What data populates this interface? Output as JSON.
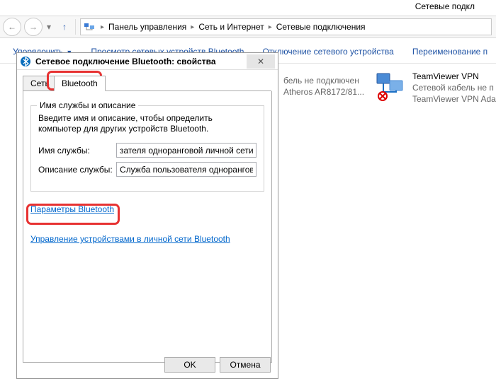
{
  "window": {
    "title": "Сетевые подкл"
  },
  "breadcrumb": {
    "seg1": "Панель управления",
    "seg2": "Сеть и Интернет",
    "seg3": "Сетевые подключения"
  },
  "cmdbar": {
    "organize": "Упорядочить",
    "view_bt": "Просмотр сетевых устройств Bluetooth",
    "disable": "Отключение сетевого устройства",
    "rename": "Переименование п"
  },
  "connections": {
    "item1": {
      "title": "TeamViewer VPN",
      "line1": "Сетевой кабель не п",
      "line2": "TeamViewer VPN Ada"
    },
    "item2_line1": "бель не подключен",
    "item2_line2": "Atheros AR8172/81..."
  },
  "dialog": {
    "title": "Сетевое подключение Bluetooth: свойства",
    "tabs": {
      "net": "Сеть",
      "bt": "Bluetooth"
    },
    "group": {
      "title": "Имя службы и описание",
      "desc": "Введите имя и описание, чтобы определить компьютер для других устройств Bluetooth.",
      "name_label": "Имя службы:",
      "name_value": "зателя одноранговой личной сети",
      "desc_label": "Описание службы:",
      "desc_value": "Служба пользователя однорангов"
    },
    "link_params": "Параметры Bluetooth",
    "link_manage": "Управление устройствами в личной сети Bluetooth",
    "ok": "OK",
    "cancel": "Отмена"
  }
}
